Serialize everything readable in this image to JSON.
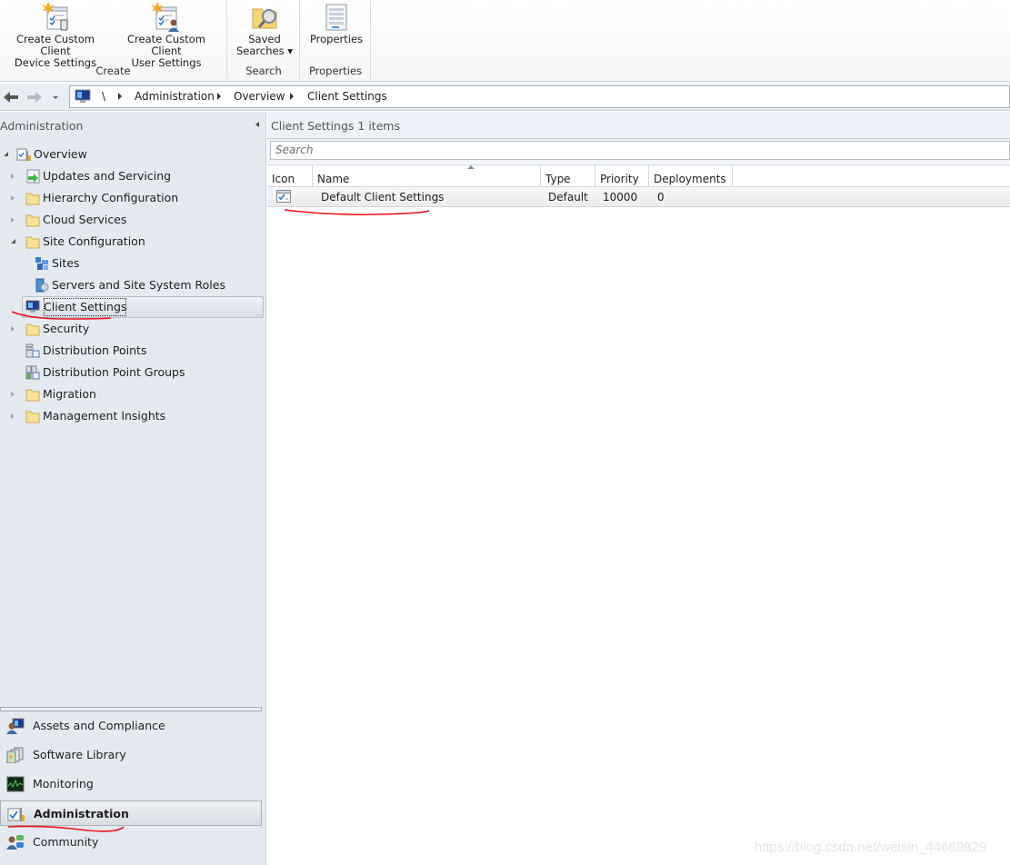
{
  "ribbon": {
    "groups": [
      {
        "label": "Create",
        "buttons": [
          {
            "label": "Create Custom Client\nDevice Settings",
            "icon": "create-device-settings-icon"
          },
          {
            "label": "Create Custom Client\nUser Settings",
            "icon": "create-user-settings-icon"
          }
        ]
      },
      {
        "label": "Search",
        "buttons": [
          {
            "label": "Saved\nSearches ▾",
            "icon": "saved-searches-icon"
          }
        ]
      },
      {
        "label": "Properties",
        "buttons": [
          {
            "label": "Properties",
            "icon": "properties-icon"
          }
        ]
      }
    ]
  },
  "address_bar": {
    "root": "\\",
    "crumbs": [
      "Administration",
      "Overview",
      "Client Settings"
    ]
  },
  "left_pane": {
    "title": "Administration",
    "tree": [
      {
        "label": "Overview",
        "level": 0,
        "state": "expanded",
        "icon": "overview-icon"
      },
      {
        "label": "Updates and Servicing",
        "level": 1,
        "state": "collapsed",
        "icon": "updates-icon"
      },
      {
        "label": "Hierarchy Configuration",
        "level": 1,
        "state": "collapsed",
        "icon": "folder-icon"
      },
      {
        "label": "Cloud Services",
        "level": 1,
        "state": "collapsed",
        "icon": "folder-icon"
      },
      {
        "label": "Site Configuration",
        "level": 1,
        "state": "expanded",
        "icon": "folder-icon"
      },
      {
        "label": "Sites",
        "level": 2,
        "state": "none",
        "icon": "sites-icon"
      },
      {
        "label": "Servers and Site System Roles",
        "level": 2,
        "state": "none",
        "icon": "servers-icon"
      },
      {
        "label": "Client Settings",
        "level": 1,
        "state": "none",
        "icon": "client-settings-icon",
        "selected": true
      },
      {
        "label": "Security",
        "level": 1,
        "state": "collapsed",
        "icon": "folder-icon"
      },
      {
        "label": "Distribution Points",
        "level": 1,
        "state": "none",
        "icon": "distribution-points-icon"
      },
      {
        "label": "Distribution Point Groups",
        "level": 1,
        "state": "none",
        "icon": "distribution-point-groups-icon"
      },
      {
        "label": "Migration",
        "level": 1,
        "state": "collapsed",
        "icon": "folder-icon"
      },
      {
        "label": "Management Insights",
        "level": 1,
        "state": "collapsed",
        "icon": "folder-icon"
      }
    ],
    "workspaces": [
      {
        "label": "Assets and Compliance",
        "icon": "assets-compliance-icon"
      },
      {
        "label": "Software Library",
        "icon": "software-library-icon"
      },
      {
        "label": "Monitoring",
        "icon": "monitoring-icon"
      },
      {
        "label": "Administration",
        "icon": "administration-icon",
        "active": true
      },
      {
        "label": "Community",
        "icon": "community-icon"
      }
    ]
  },
  "right_pane": {
    "title": "Client Settings 1 items",
    "search_placeholder": "Search",
    "columns": [
      "Icon",
      "Name",
      "Type",
      "Priority",
      "Deployments"
    ],
    "sorted_column": "Name",
    "rows": [
      {
        "icon": "client-settings-row-icon",
        "name": "Default Client Settings",
        "type": "Default",
        "priority": "10000",
        "deployments": "0"
      }
    ]
  },
  "annotations": {
    "underline_color": "#e8141c"
  },
  "watermark": "https://blog.csdn.net/weixin_44669829"
}
